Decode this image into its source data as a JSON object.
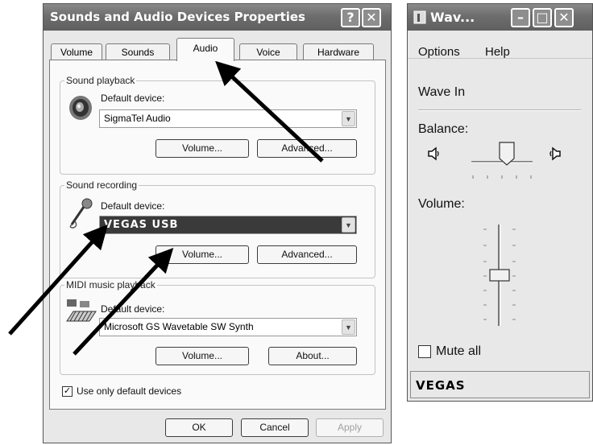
{
  "props_window": {
    "title": "Sounds and Audio Devices Properties",
    "help_btn": "?",
    "close_btn": "✕",
    "tabs": [
      "Volume",
      "Sounds",
      "Audio",
      "Voice",
      "Hardware"
    ],
    "active_tab": "Audio",
    "playback": {
      "group_label": "Sound playback",
      "default_label": "Default device:",
      "device": "SigmaTel Audio",
      "volume_btn": "Volume...",
      "advanced_btn": "Advanced..."
    },
    "recording": {
      "group_label": "Sound recording",
      "default_label": "Default device:",
      "device": "VEGAS USB",
      "volume_btn": "Volume...",
      "advanced_btn": "Advanced..."
    },
    "midi": {
      "group_label": "MIDI music playback",
      "default_label": "Default device:",
      "device": "Microsoft GS Wavetable SW Synth",
      "volume_btn": "Volume...",
      "about_btn": "About..."
    },
    "use_only_default": {
      "label": "Use only default devices",
      "checked": true
    },
    "ok_btn": "OK",
    "cancel_btn": "Cancel",
    "apply_btn": "Apply"
  },
  "wave_window": {
    "title": "Wav...",
    "minimize_btn": "–",
    "maximize_btn": "□",
    "close_btn": "✕",
    "menu": [
      "Options",
      "Help"
    ],
    "section": "Wave In",
    "balance_label": "Balance:",
    "balance_value": 0.5,
    "volume_label": "Volume:",
    "volume_value": 0.5,
    "mute_label": "Mute all",
    "mute_checked": false,
    "status": "VEGAS"
  },
  "icons": [
    "speaker-icon",
    "microphone-icon",
    "midi-keyboard-icon",
    "wave-app-icon",
    "speaker-left-icon",
    "speaker-right-icon",
    "annotation-arrow"
  ]
}
